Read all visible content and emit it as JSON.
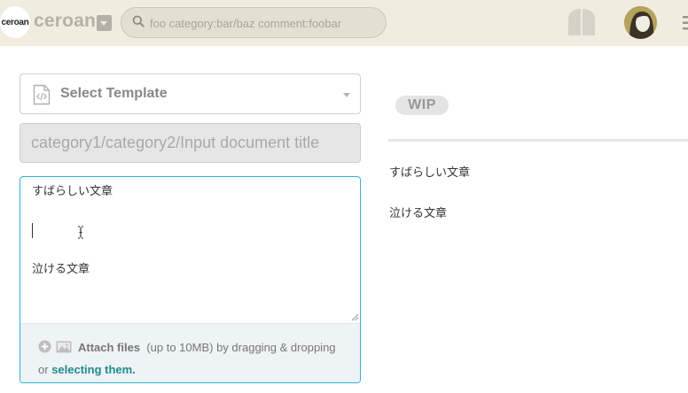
{
  "header": {
    "logo_text": "ceroan",
    "team_name": "ceroan",
    "search_placeholder": "foo category:bar/baz comment:foobar",
    "icons": {
      "search": "search-icon",
      "book": "book-icon",
      "menu": "menu-icon"
    },
    "colors": {
      "header_bg": "#f0ece0",
      "muted": "#b5b1a6"
    }
  },
  "editor": {
    "template_label": "Select Template",
    "title_placeholder": "category1/category2/Input document title",
    "body_lines": [
      "すばらしい文章",
      "",
      "",
      "",
      "",
      "泣ける文章"
    ],
    "attach": {
      "bold_label": "Attach files",
      "size_limit": "(up to 10MB)",
      "text_before_link": "by dragging & dropping or",
      "link_label": "selecting them."
    },
    "colors": {
      "focus_border": "#33b3d6",
      "link": "#1f8a8a"
    }
  },
  "preview": {
    "badge": "WIP",
    "lines": [
      "すばらしい文章",
      "泣ける文章"
    ]
  }
}
